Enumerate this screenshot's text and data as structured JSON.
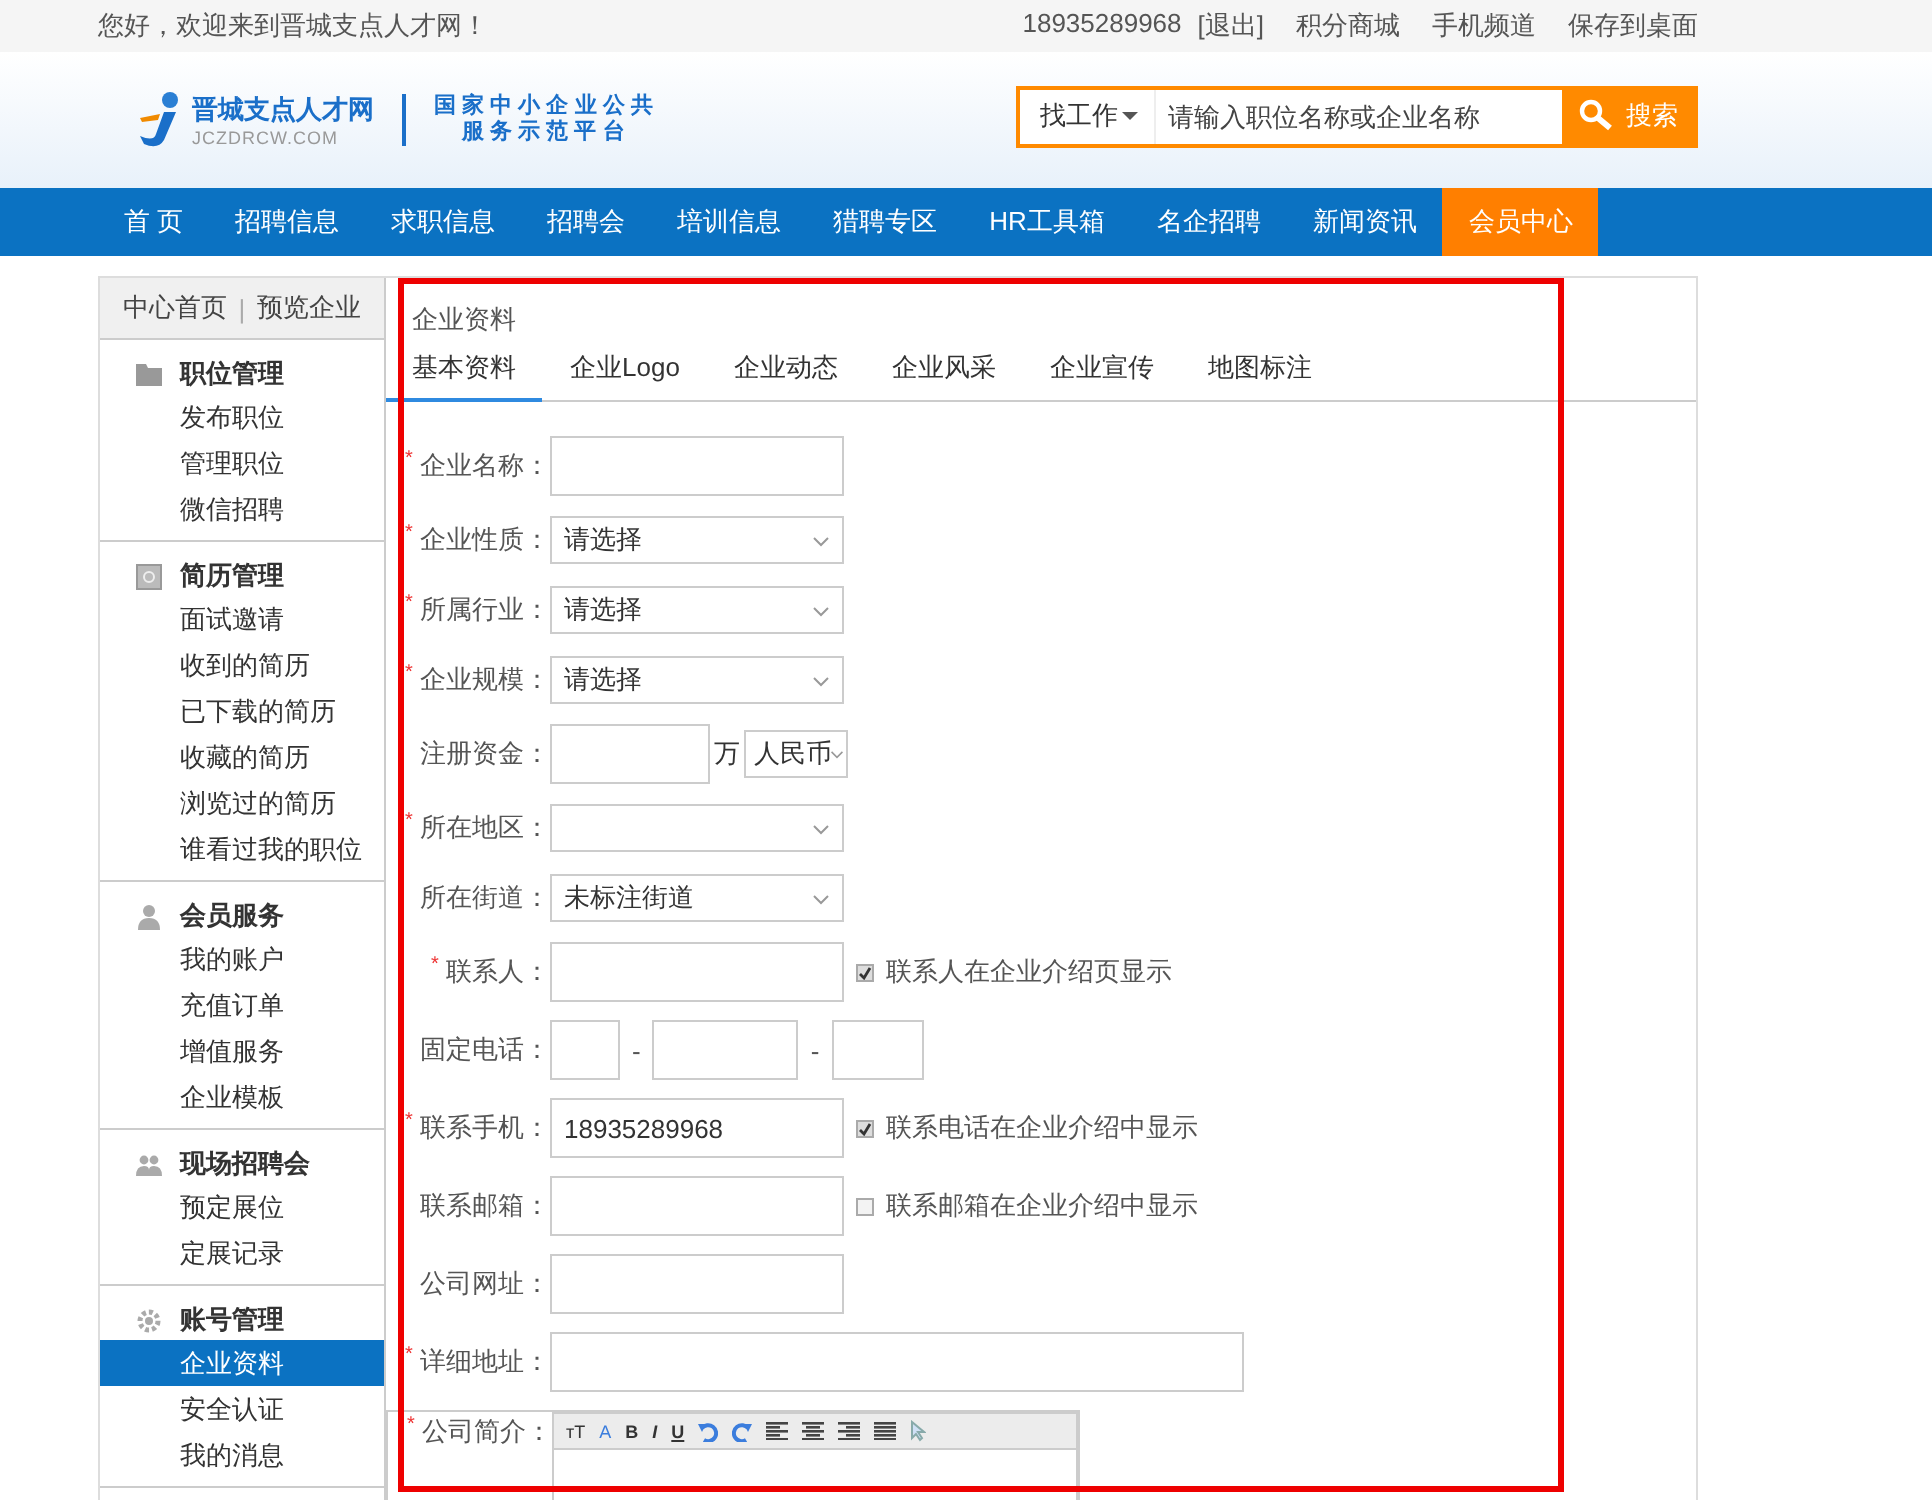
{
  "top_bar": {
    "greeting": "您好，欢迎来到晋城支点人才网！",
    "links": [
      "18935289968",
      "[退出]",
      "积分商城",
      "手机频道",
      "保存到桌面"
    ]
  },
  "header": {
    "logo_name": "晋城支点人才网",
    "logo_domain": "JCZDRCW.COM",
    "slogan_lines": [
      "国 家 中 小 企 业 公 共",
      "服 务 示 范 平 台"
    ],
    "search": {
      "category": "找工作",
      "placeholder": "请输入职位名称或企业名称",
      "button": "搜索"
    }
  },
  "nav": [
    {
      "label": "首 页",
      "selected": false
    },
    {
      "label": "招聘信息",
      "selected": false
    },
    {
      "label": "求职信息",
      "selected": false
    },
    {
      "label": "招聘会",
      "selected": false
    },
    {
      "label": "培训信息",
      "selected": false
    },
    {
      "label": "猎聘专区",
      "selected": false
    },
    {
      "label": "HR工具箱",
      "selected": false
    },
    {
      "label": "名企招聘",
      "selected": false
    },
    {
      "label": "新闻资讯",
      "selected": false
    },
    {
      "label": "会员中心",
      "selected": true
    }
  ],
  "sidebar": {
    "top_links": [
      "中心首页",
      "|",
      "预览企业"
    ],
    "groups": [
      {
        "title": "职位管理",
        "items": [
          {
            "label": "发布职位",
            "selected": false
          },
          {
            "label": "管理职位",
            "selected": false
          },
          {
            "label": "微信招聘",
            "selected": false
          }
        ]
      },
      {
        "title": "简历管理",
        "items": [
          {
            "label": "面试邀请",
            "selected": false
          },
          {
            "label": "收到的简历",
            "selected": false
          },
          {
            "label": "已下载的简历",
            "selected": false
          },
          {
            "label": "收藏的简历",
            "selected": false
          },
          {
            "label": "浏览过的简历",
            "selected": false
          },
          {
            "label": "谁看过我的职位",
            "selected": false
          }
        ]
      },
      {
        "title": "会员服务",
        "items": [
          {
            "label": "我的账户",
            "selected": false
          },
          {
            "label": "充值订单",
            "selected": false
          },
          {
            "label": "增值服务",
            "selected": false
          },
          {
            "label": "企业模板",
            "selected": false
          }
        ]
      },
      {
        "title": "现场招聘会",
        "items": [
          {
            "label": "预定展位",
            "selected": false
          },
          {
            "label": "定展记录",
            "selected": false
          }
        ]
      },
      {
        "title": "账号管理",
        "items": [
          {
            "label": "企业资料",
            "selected": true
          },
          {
            "label": "安全认证",
            "selected": false
          },
          {
            "label": "我的消息",
            "selected": false
          }
        ]
      }
    ]
  },
  "panel": {
    "title": "企业资料",
    "required_mark": "*",
    "tabs": [
      {
        "label": "基本资料",
        "selected": true
      },
      {
        "label": "企业Logo",
        "selected": false
      },
      {
        "label": "企业动态",
        "selected": false
      },
      {
        "label": "企业风采",
        "selected": false
      },
      {
        "label": "企业宣传",
        "selected": false
      },
      {
        "label": "地图标注",
        "selected": false
      }
    ],
    "fields": [
      {
        "kind": "text",
        "label": "企业名称：",
        "required": true
      },
      {
        "kind": "select",
        "label": "企业性质：",
        "required": true,
        "value": "请选择"
      },
      {
        "kind": "select",
        "label": "所属行业：",
        "required": true,
        "value": "请选择"
      },
      {
        "kind": "select",
        "label": "企业规模：",
        "required": true,
        "value": "请选择"
      },
      {
        "kind": "money",
        "label": "注册资金：",
        "required": false,
        "unit": "万",
        "currency": "人民币"
      },
      {
        "kind": "select",
        "label": "所在地区：",
        "required": true
      },
      {
        "kind": "select",
        "label": "所在街道：",
        "required": false,
        "value": "未标注街道"
      },
      {
        "kind": "text",
        "label": "联系人：",
        "required": true,
        "option": {
          "label": "联系人在企业介绍页显示",
          "checked": true
        }
      },
      {
        "kind": "phone",
        "label": "固定电话：",
        "required": false,
        "separator": "-"
      },
      {
        "kind": "text",
        "label": "联系手机：",
        "required": true,
        "value": "18935289968",
        "option": {
          "label": "联系电话在企业介绍中显示",
          "checked": true
        }
      },
      {
        "kind": "text",
        "label": "联系邮箱：",
        "required": false,
        "option": {
          "label": "联系邮箱在企业介绍中显示",
          "checked": false
        }
      },
      {
        "kind": "text",
        "label": "公司网址：",
        "required": false
      },
      {
        "kind": "wide",
        "label": "详细地址：",
        "required": true
      },
      {
        "kind": "editor",
        "label": "公司简介：",
        "required": true
      }
    ]
  },
  "editor_toolbar": [
    {
      "kind": "size",
      "label": "тT"
    },
    {
      "kind": "color",
      "label": "A"
    },
    {
      "kind": "bold",
      "label": "B"
    },
    {
      "kind": "italic",
      "label": "I"
    },
    {
      "kind": "underline",
      "label": "U"
    },
    {
      "kind": "undo"
    },
    {
      "kind": "redo"
    },
    {
      "kind": "align-left"
    },
    {
      "kind": "align-center"
    },
    {
      "kind": "align-right"
    },
    {
      "kind": "justify"
    },
    {
      "kind": "cursor"
    }
  ],
  "annotation": {
    "kind": "frame"
  }
}
